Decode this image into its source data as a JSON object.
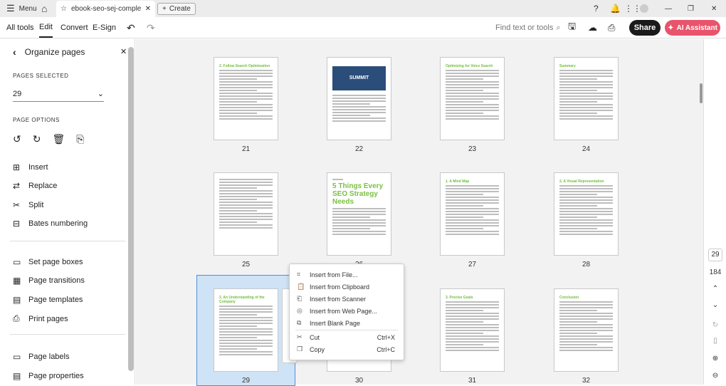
{
  "topbar": {
    "menu": "Menu",
    "tab_title": "ebook-seo-sej-complete-...",
    "create": "Create"
  },
  "toolbar": {
    "tabs": [
      "All tools",
      "Edit",
      "Convert",
      "E-Sign"
    ],
    "active_tab": "Edit",
    "search_placeholder": "Find text or tools",
    "share": "Share",
    "ai_assistant": "AI Assistant"
  },
  "panel": {
    "title": "Organize pages",
    "pages_selected_label": "PAGES SELECTED",
    "pages_selected_value": "29",
    "page_options_label": "PAGE OPTIONS",
    "items": [
      {
        "label": "Insert",
        "icon": "insert-icon"
      },
      {
        "label": "Replace",
        "icon": "replace-icon"
      },
      {
        "label": "Split",
        "icon": "split-icon"
      },
      {
        "label": "Bates numbering",
        "icon": "bates-icon"
      }
    ],
    "items2": [
      {
        "label": "Set page boxes"
      },
      {
        "label": "Page transitions"
      },
      {
        "label": "Page templates"
      },
      {
        "label": "Print pages"
      }
    ],
    "items3": [
      {
        "label": "Page labels"
      },
      {
        "label": "Page properties"
      }
    ]
  },
  "pages": [
    {
      "n": "21",
      "head": "2. Follow Search Optimization"
    },
    {
      "n": "22",
      "head": "SUMMIT"
    },
    {
      "n": "23",
      "head": "Optimizing for Voice Search"
    },
    {
      "n": "24",
      "head": "Summary"
    },
    {
      "n": "25",
      "head": ""
    },
    {
      "n": "26",
      "big": "5 Things Every SEO Strategy Needs"
    },
    {
      "n": "27",
      "head": "1. A Mind Map"
    },
    {
      "n": "28",
      "head": "2. A Visual Representation"
    },
    {
      "n": "29",
      "head": "2. An Understanding of the Company"
    },
    {
      "n": "30",
      "head": ""
    },
    {
      "n": "31",
      "head": "3. Precise Goals"
    },
    {
      "n": "32",
      "head": "Conclusion"
    }
  ],
  "selected_page": "29",
  "context_menu": [
    {
      "label": "Insert from File...",
      "icon": "file-icon"
    },
    {
      "label": "Insert from Clipboard",
      "icon": "clipboard-icon"
    },
    {
      "label": "Insert from Scanner",
      "icon": "scanner-icon"
    },
    {
      "label": "Insert from Web Page...",
      "icon": "web-icon"
    },
    {
      "label": "Insert Blank Page",
      "icon": "blank-page-icon"
    },
    {
      "label": "Cut",
      "shortcut": "Ctrl+X",
      "icon": "cut-icon"
    },
    {
      "label": "Copy",
      "shortcut": "Ctrl+C",
      "icon": "copy-icon"
    }
  ],
  "rail": {
    "current_page": "29",
    "total_pages": "184"
  },
  "colors": {
    "accent": "#4a90d9",
    "ai": "#e8546b",
    "heading_green": "#6fbf3b"
  }
}
